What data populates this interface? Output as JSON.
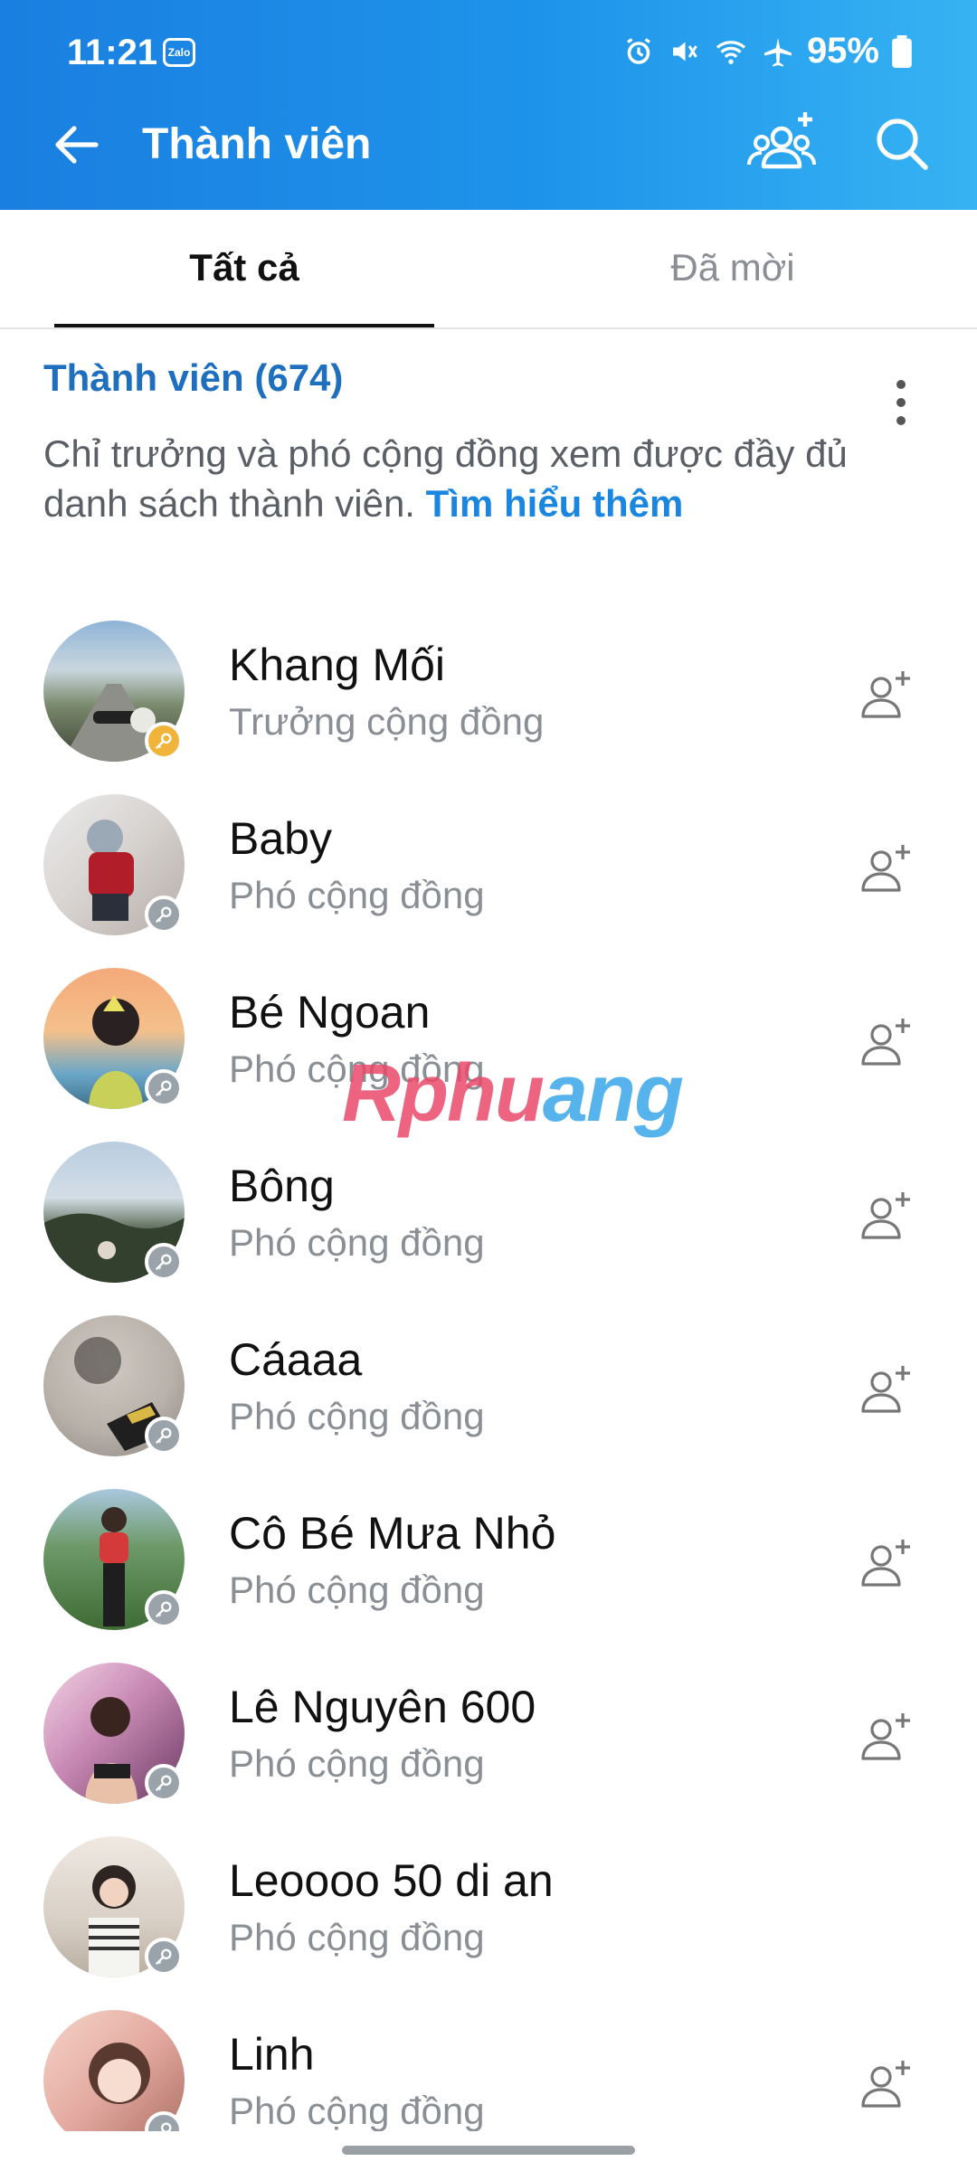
{
  "status_bar": {
    "time": "11:21",
    "app_badge": "Zalo",
    "battery": "95%"
  },
  "header": {
    "title": "Thành viên",
    "back_icon": "arrow-left-icon",
    "add_members_icon": "add-group-icon",
    "search_icon": "search-icon"
  },
  "tabs": [
    {
      "label": "Tất cả",
      "active": true
    },
    {
      "label": "Đã mời",
      "active": false
    }
  ],
  "section": {
    "title": "Thành viên (674)",
    "info_text": "Chỉ trưởng và phó cộng đồng xem được đầy đủ danh sách thành viên.",
    "info_link": "Tìm hiểu thêm"
  },
  "members": [
    {
      "name": "Khang Mối",
      "role": "Trưởng cộng đồng",
      "owner": true,
      "add_friend": true
    },
    {
      "name": "Baby",
      "role": "Phó cộng đồng",
      "owner": false,
      "add_friend": true
    },
    {
      "name": "Bé Ngoan",
      "role": "Phó cộng đồng",
      "owner": false,
      "add_friend": true
    },
    {
      "name": "Bông",
      "role": "Phó cộng đồng",
      "owner": false,
      "add_friend": true
    },
    {
      "name": "Cáaaa",
      "role": "Phó cộng đồng",
      "owner": false,
      "add_friend": true
    },
    {
      "name": "Cô Bé Mưa Nhỏ",
      "role": "Phó cộng đồng",
      "owner": false,
      "add_friend": true
    },
    {
      "name": "Lê Nguyên 600",
      "role": "Phó cộng đồng",
      "owner": false,
      "add_friend": true
    },
    {
      "name": "Leoooo 50 di an",
      "role": "Phó cộng đồng",
      "owner": false,
      "add_friend": false
    },
    {
      "name": "Linh",
      "role": "Phó cộng đồng",
      "owner": false,
      "add_friend": true
    }
  ],
  "watermark": {
    "text_main": "Rphu",
    "text_tail": "ang"
  },
  "colors": {
    "header_start": "#1a7fe0",
    "header_end": "#36b3f3",
    "link": "#1a86e0",
    "section_title": "#1f6fbf",
    "owner_key": "#f0b43a",
    "deputy_key": "#9aa2aa"
  }
}
